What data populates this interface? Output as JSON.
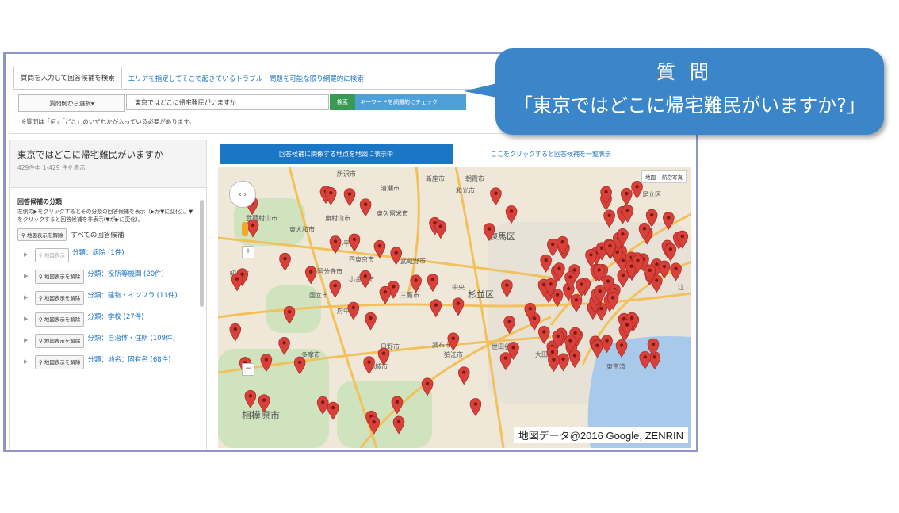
{
  "tabs": {
    "search_tab": "質問を入力して回答候補を検索",
    "area_tab": "エリアを指定してそこで起きているトラブル・問題を可能な限り網羅的に検索"
  },
  "search": {
    "select_label": "質問例から選択▾",
    "query": "東京ではどこに帰宅難民がいますか",
    "search_button": "検索",
    "keyword_button": "キーワードを網羅的にチェック",
    "note": "※質問は「何」「どこ」のいずれかが入っている必要があります。"
  },
  "results": {
    "title": "東京ではどこに帰宅難民がいますか",
    "count": "429件中 1-429 件を表示",
    "category_title": "回答候補の分類",
    "category_desc": "左側の▶をクリックするとその分類の回答候補を表示（▶が▼に変化）。▼をクリックすると回答候補を非表示(▼が▶に変化)。",
    "all_button": "地図表示を解除",
    "all_label": "すべての回答候補",
    "categories": [
      {
        "button": "地図表示",
        "label": "分類：病院 (1件)",
        "dim": true
      },
      {
        "button": "地図表示を解除",
        "label": "分類：役所等機関 (20件)"
      },
      {
        "button": "地図表示を解除",
        "label": "分類：建物・インフラ (13件)"
      },
      {
        "button": "地図表示を解除",
        "label": "分類：学校 (27件)"
      },
      {
        "button": "地図表示を解除",
        "label": "分類：自治体・住所 (109件)"
      },
      {
        "button": "地図表示を解除",
        "label": "分類：地名：固有名 (68件)"
      }
    ]
  },
  "map_panel": {
    "map_button": "回答候補に関係する地点を地図に表示中",
    "list_link": "ここをクリックすると回答候補を一覧表示",
    "maptype_map": "地図",
    "maptype_sat": "航空写真",
    "credit": "地図データ@2016 Google, ZENRIN",
    "labels": [
      {
        "text": "所沢市"
      },
      {
        "text": "清瀬市"
      },
      {
        "text": "新座市"
      },
      {
        "text": "朝霞市"
      },
      {
        "text": "和光市"
      },
      {
        "text": "武蔵村山市"
      },
      {
        "text": "東村山市"
      },
      {
        "text": "東久留米市"
      },
      {
        "text": "東大和市"
      },
      {
        "text": "練馬区"
      },
      {
        "text": "足立区"
      },
      {
        "text": "小平市"
      },
      {
        "text": "西東京市"
      },
      {
        "text": "武蔵野市"
      },
      {
        "text": "昭島市"
      },
      {
        "text": "国分寺市"
      },
      {
        "text": "小金井市"
      },
      {
        "text": "中央"
      },
      {
        "text": "杉並区"
      },
      {
        "text": "国立市"
      },
      {
        "text": "三鷹市"
      },
      {
        "text": "府中市"
      },
      {
        "text": "調布市"
      },
      {
        "text": "日野市"
      },
      {
        "text": "稲城市"
      },
      {
        "text": "狛江市"
      },
      {
        "text": "世田谷区"
      },
      {
        "text": "大田区"
      },
      {
        "text": "多摩市"
      },
      {
        "text": "相模原市"
      },
      {
        "text": "東京湾"
      },
      {
        "text": "江"
      }
    ]
  },
  "callout": {
    "title": "質問",
    "question": "「東京ではどこに帰宅難民がいますか?」"
  },
  "colors": {
    "accent_blue": "#1b77c5",
    "callout_blue": "#3a86c8",
    "pin_red": "#d9403a",
    "frame": "#8f97c8"
  }
}
